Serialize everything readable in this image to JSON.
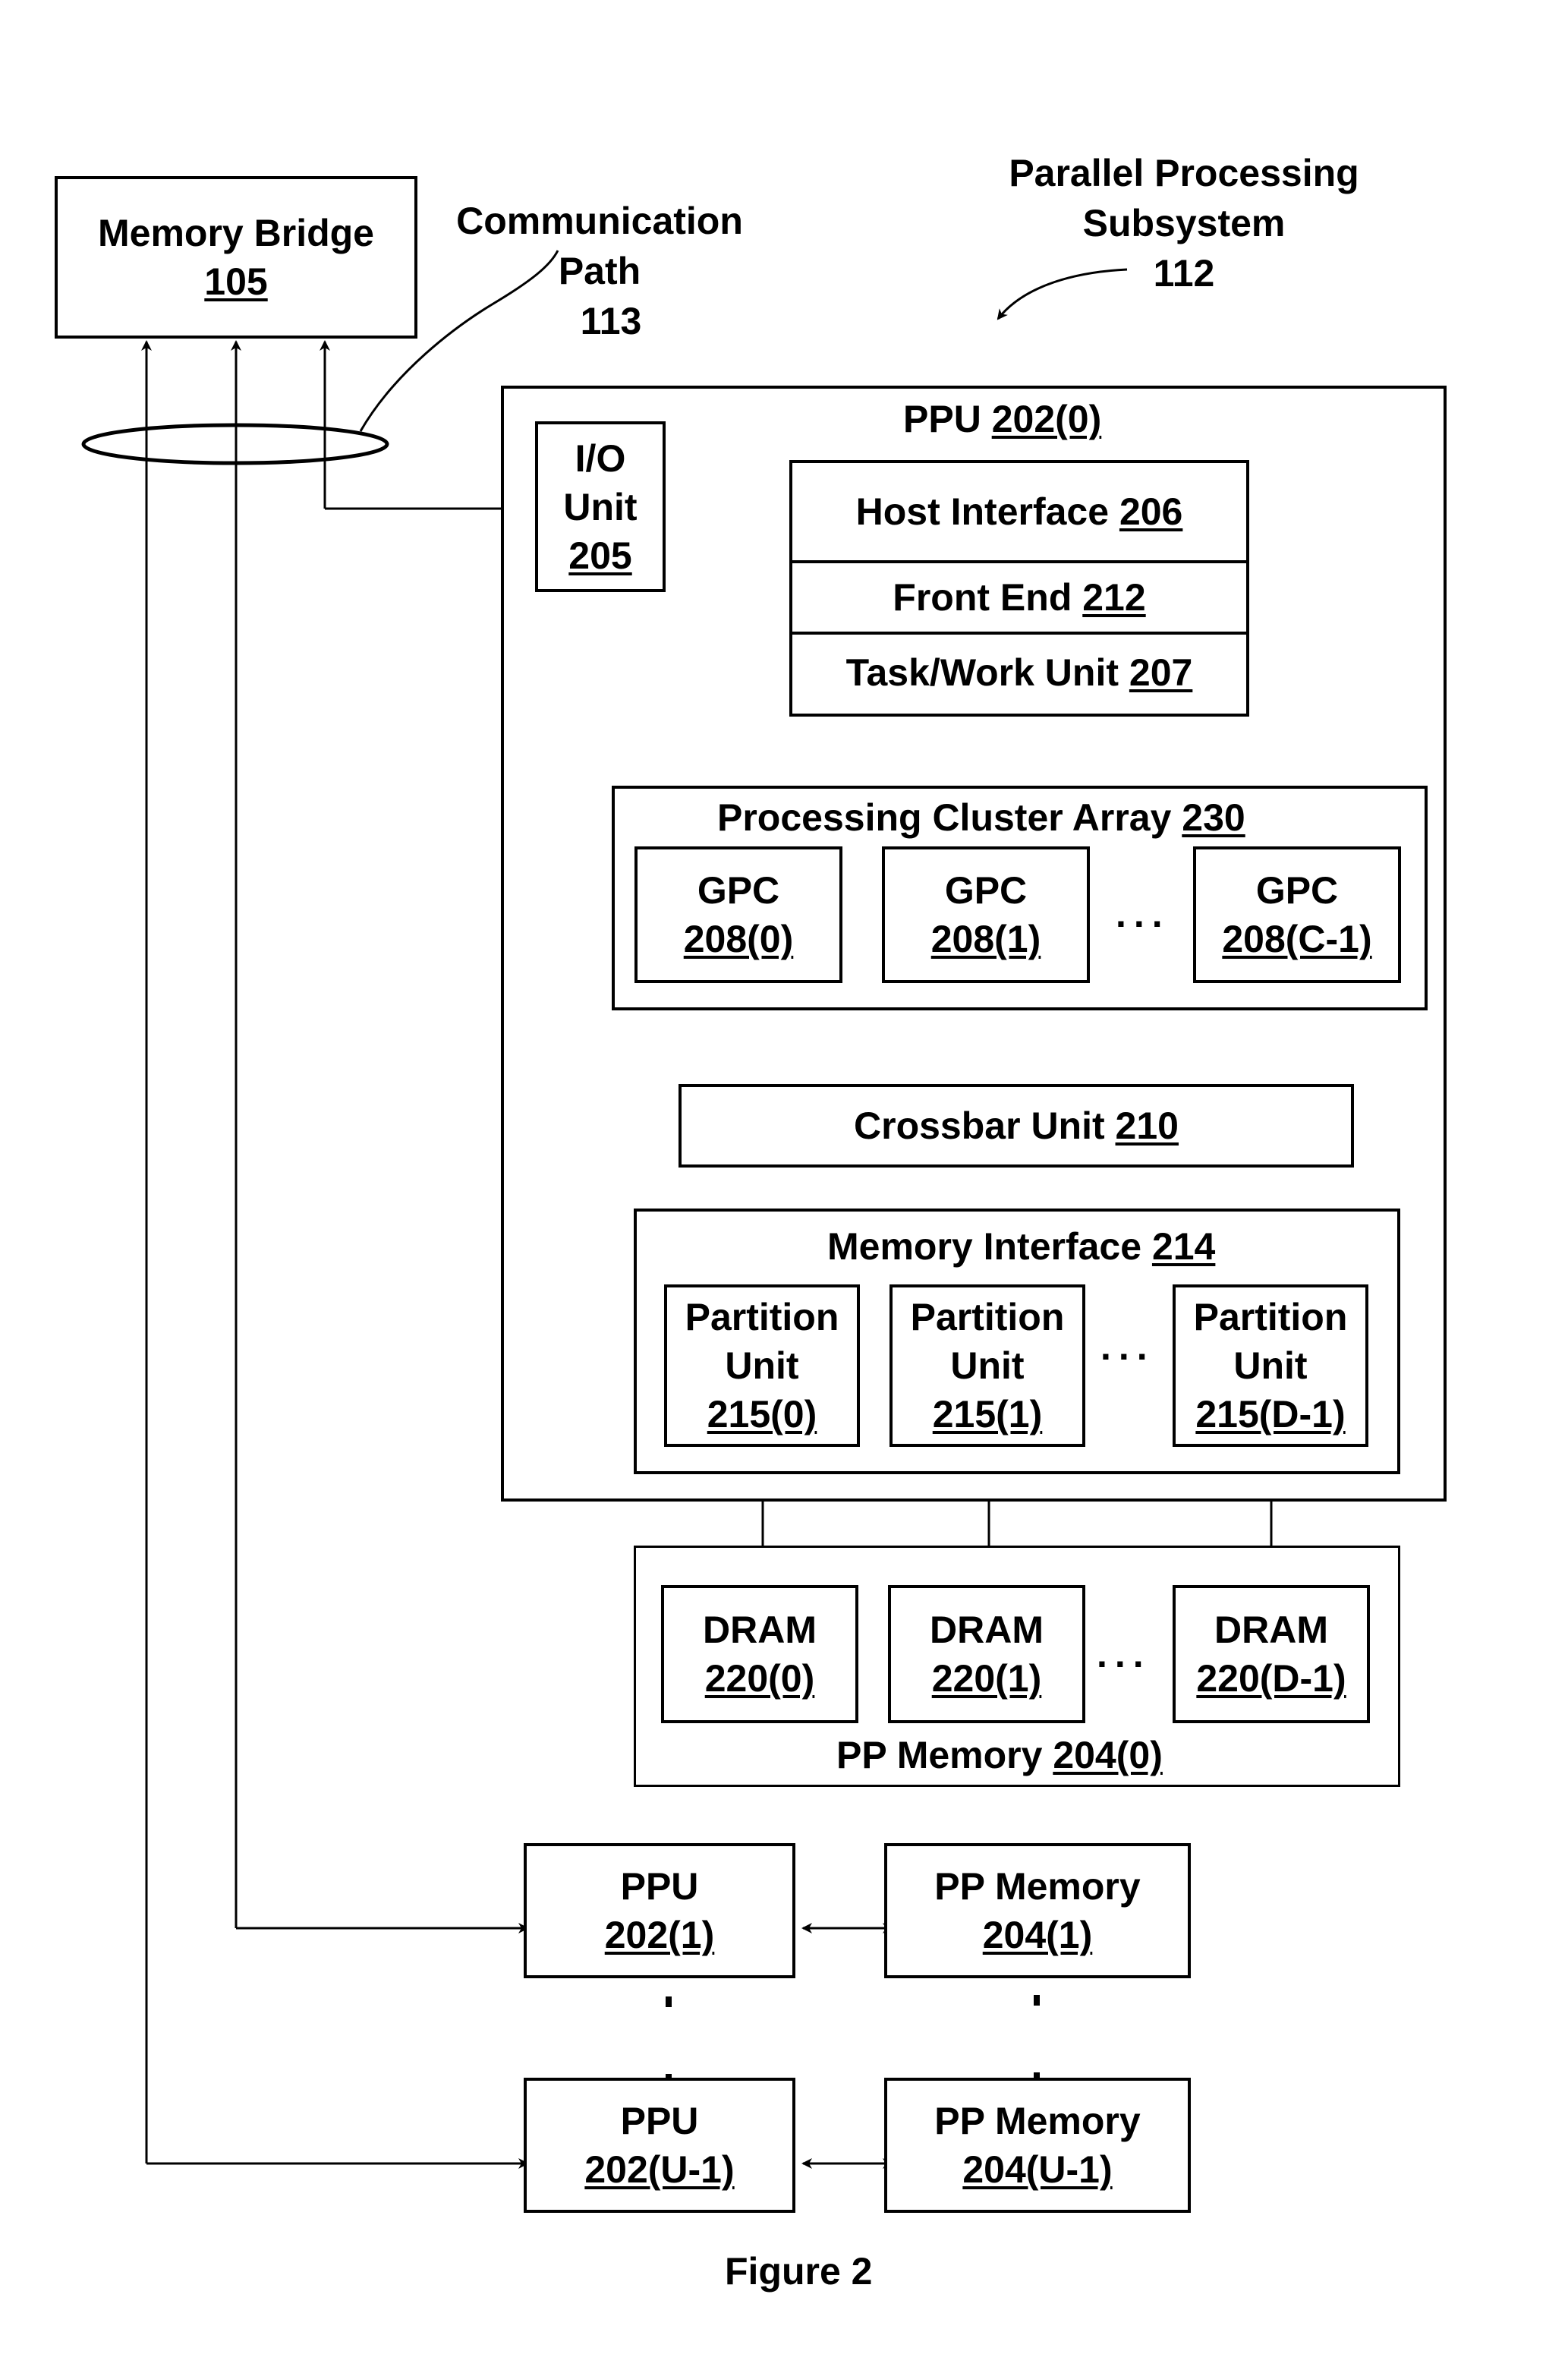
{
  "figure": {
    "caption": "Figure 2",
    "subsystem_label_line1": "Parallel Processing",
    "subsystem_label_line2": "Subsystem",
    "subsystem_ref": "112",
    "comm_path_line1": "Communication",
    "comm_path_line2": "Path",
    "comm_path_ref": "113"
  },
  "memory_bridge": {
    "label": "Memory Bridge",
    "ref": "105"
  },
  "ppu0": {
    "label": "PPU ",
    "ref": "202(0)",
    "io_unit": {
      "line1": "I/O",
      "line2": "Unit",
      "ref": "205"
    },
    "host_interface": {
      "label": "Host Interface ",
      "ref": "206"
    },
    "front_end": {
      "label": "Front End ",
      "ref": "212"
    },
    "task_work_unit": {
      "label": "Task/Work Unit ",
      "ref": "207"
    },
    "pca": {
      "label": "Processing Cluster Array ",
      "ref": "230",
      "gpcs": [
        {
          "label": "GPC",
          "ref": "208(0)"
        },
        {
          "label": "GPC",
          "ref": "208(1)"
        },
        {
          "label": "GPC",
          "ref": "208(C-1)"
        }
      ],
      "ellipsis": "..."
    },
    "crossbar": {
      "label": "Crossbar Unit ",
      "ref": "210"
    },
    "memory_interface": {
      "label": "Memory Interface ",
      "ref": "214",
      "partitions": [
        {
          "line1": "Partition",
          "line2": "Unit",
          "ref": "215(0)"
        },
        {
          "line1": "Partition",
          "line2": "Unit",
          "ref": "215(1)"
        },
        {
          "line1": "Partition",
          "line2": "Unit",
          "ref": "215(D-1)"
        }
      ],
      "ellipsis": "..."
    }
  },
  "pp_memory0": {
    "label": "PP Memory ",
    "ref": "204(0)",
    "drams": [
      {
        "label": "DRAM",
        "ref": "220(0)"
      },
      {
        "label": "DRAM",
        "ref": "220(1)"
      },
      {
        "label": "DRAM",
        "ref": "220(D-1)"
      }
    ],
    "ellipsis": "..."
  },
  "other_ppus": [
    {
      "ppu_label": "PPU",
      "ppu_ref": "202(1)",
      "mem_label": "PP Memory",
      "mem_ref": "204(1)"
    },
    {
      "ppu_label": "PPU",
      "ppu_ref": "202(U-1)",
      "mem_label": "PP Memory",
      "mem_ref": "204(U-1)"
    }
  ]
}
